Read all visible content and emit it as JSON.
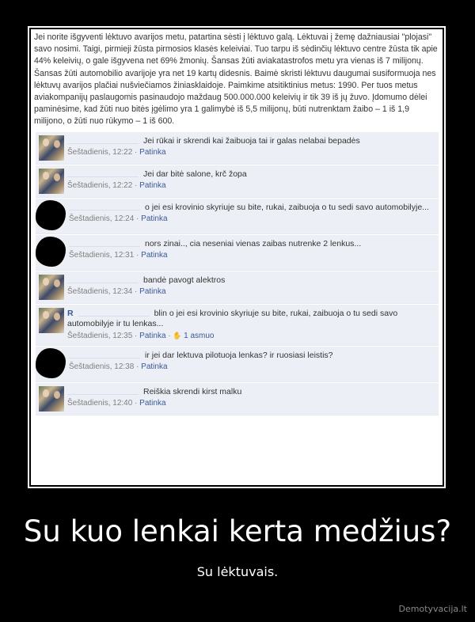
{
  "post": {
    "text": "Jei norite išgyventi lėktuvo avarijos metu, patartina sėsti į lėktuvo galą. Lėktuvai į žemę dažniausiai \"plojasi\" savo nosimi. Taigi, pirmieji žūsta pirmosios klasės keleiviai. Tuo tarpu iš sėdinčių lėktuvo centre žūsta tik apie 44% keleivių, o gale išgyvena net 69% žmonių. Šansas žūti aviakatastrofos metu yra vienas iš 7 milijonų. Šansas žūti automobilio avarijoje yra net 19 kartų didesnis. Baimė skristi lėktuvu daugumai susiformuoja nes lėktuvų avarijos plačiai nušviečiamos žiniasklaidoje. Paimkime atsitiktinius metus: 1990. Per tuos metus aviakompanijų paslaugomis pasinaudojo maždaug 500.000.000 keleivių ir tik 39 iš jų žuvo. Įdomumo dėlei paminėsime, kad žūti nuo bitės įgėlimo yra 1 galimybė iš 5,5 milijonų, būti nutrenktam žaibo – 1 iš 1,9 milijono, o žūti nuo rūkymo – 1 iš 600."
  },
  "comments": [
    {
      "avatar": "photo",
      "name": "",
      "text": "Jei rūkai ir skrendi kai žaibuoja tai ir galas nelabai bepadės",
      "time": "Šeštadienis, 12:22",
      "like": "Patinka",
      "likes": ""
    },
    {
      "avatar": "photo",
      "name": "",
      "text": "Jei dar bitė salone, krč žopa",
      "time": "Šeštadienis, 12:22",
      "like": "Patinka",
      "likes": ""
    },
    {
      "avatar": "blot",
      "name": "",
      "text": "o jei esi krovinio skyriuje su bite, rukai, zaibuoja o tu sedi savo automobilyje...",
      "time": "Šeštadienis, 12:24",
      "like": "Patinka",
      "likes": ""
    },
    {
      "avatar": "blot",
      "name": "",
      "text": "nors zinai.., cia neseniai vienas zaibas nutrenke 2 lenkus...",
      "time": "Šeštadienis, 12:31",
      "like": "Patinka",
      "likes": ""
    },
    {
      "avatar": "photo",
      "name": "",
      "text": "bandė pavogt alektros",
      "time": "Šeštadienis, 12:34",
      "like": "Patinka",
      "likes": ""
    },
    {
      "avatar": "photo",
      "name": "R",
      "text": "blin o jei esi krovinio skyriuje su bite, rukai, zaibuoja o tu sedi savo automobilyje ir tu lenkas...",
      "time": "Šeštadienis, 12:35",
      "like": "Patinka",
      "likes": "1 asmuo"
    },
    {
      "avatar": "blot",
      "name": "",
      "text": "ir jei dar lektuva pilotuoja lenkas? ir ruosiasi leistis?",
      "time": "Šeštadienis, 12:38",
      "like": "Patinka",
      "likes": ""
    },
    {
      "avatar": "photo",
      "name": "",
      "text": "Reiškia skrendi kirst malku",
      "time": "Šeštadienis, 12:40",
      "like": "Patinka",
      "likes": ""
    }
  ],
  "caption": {
    "title": "Su kuo lenkai kerta medžius?",
    "subtitle": "Su lėktuvais."
  },
  "watermark": "Demotyvacija.lt",
  "colors": {
    "link": "#3b5998",
    "comment_bg": "#eceff5",
    "page_bg": "#000000"
  }
}
